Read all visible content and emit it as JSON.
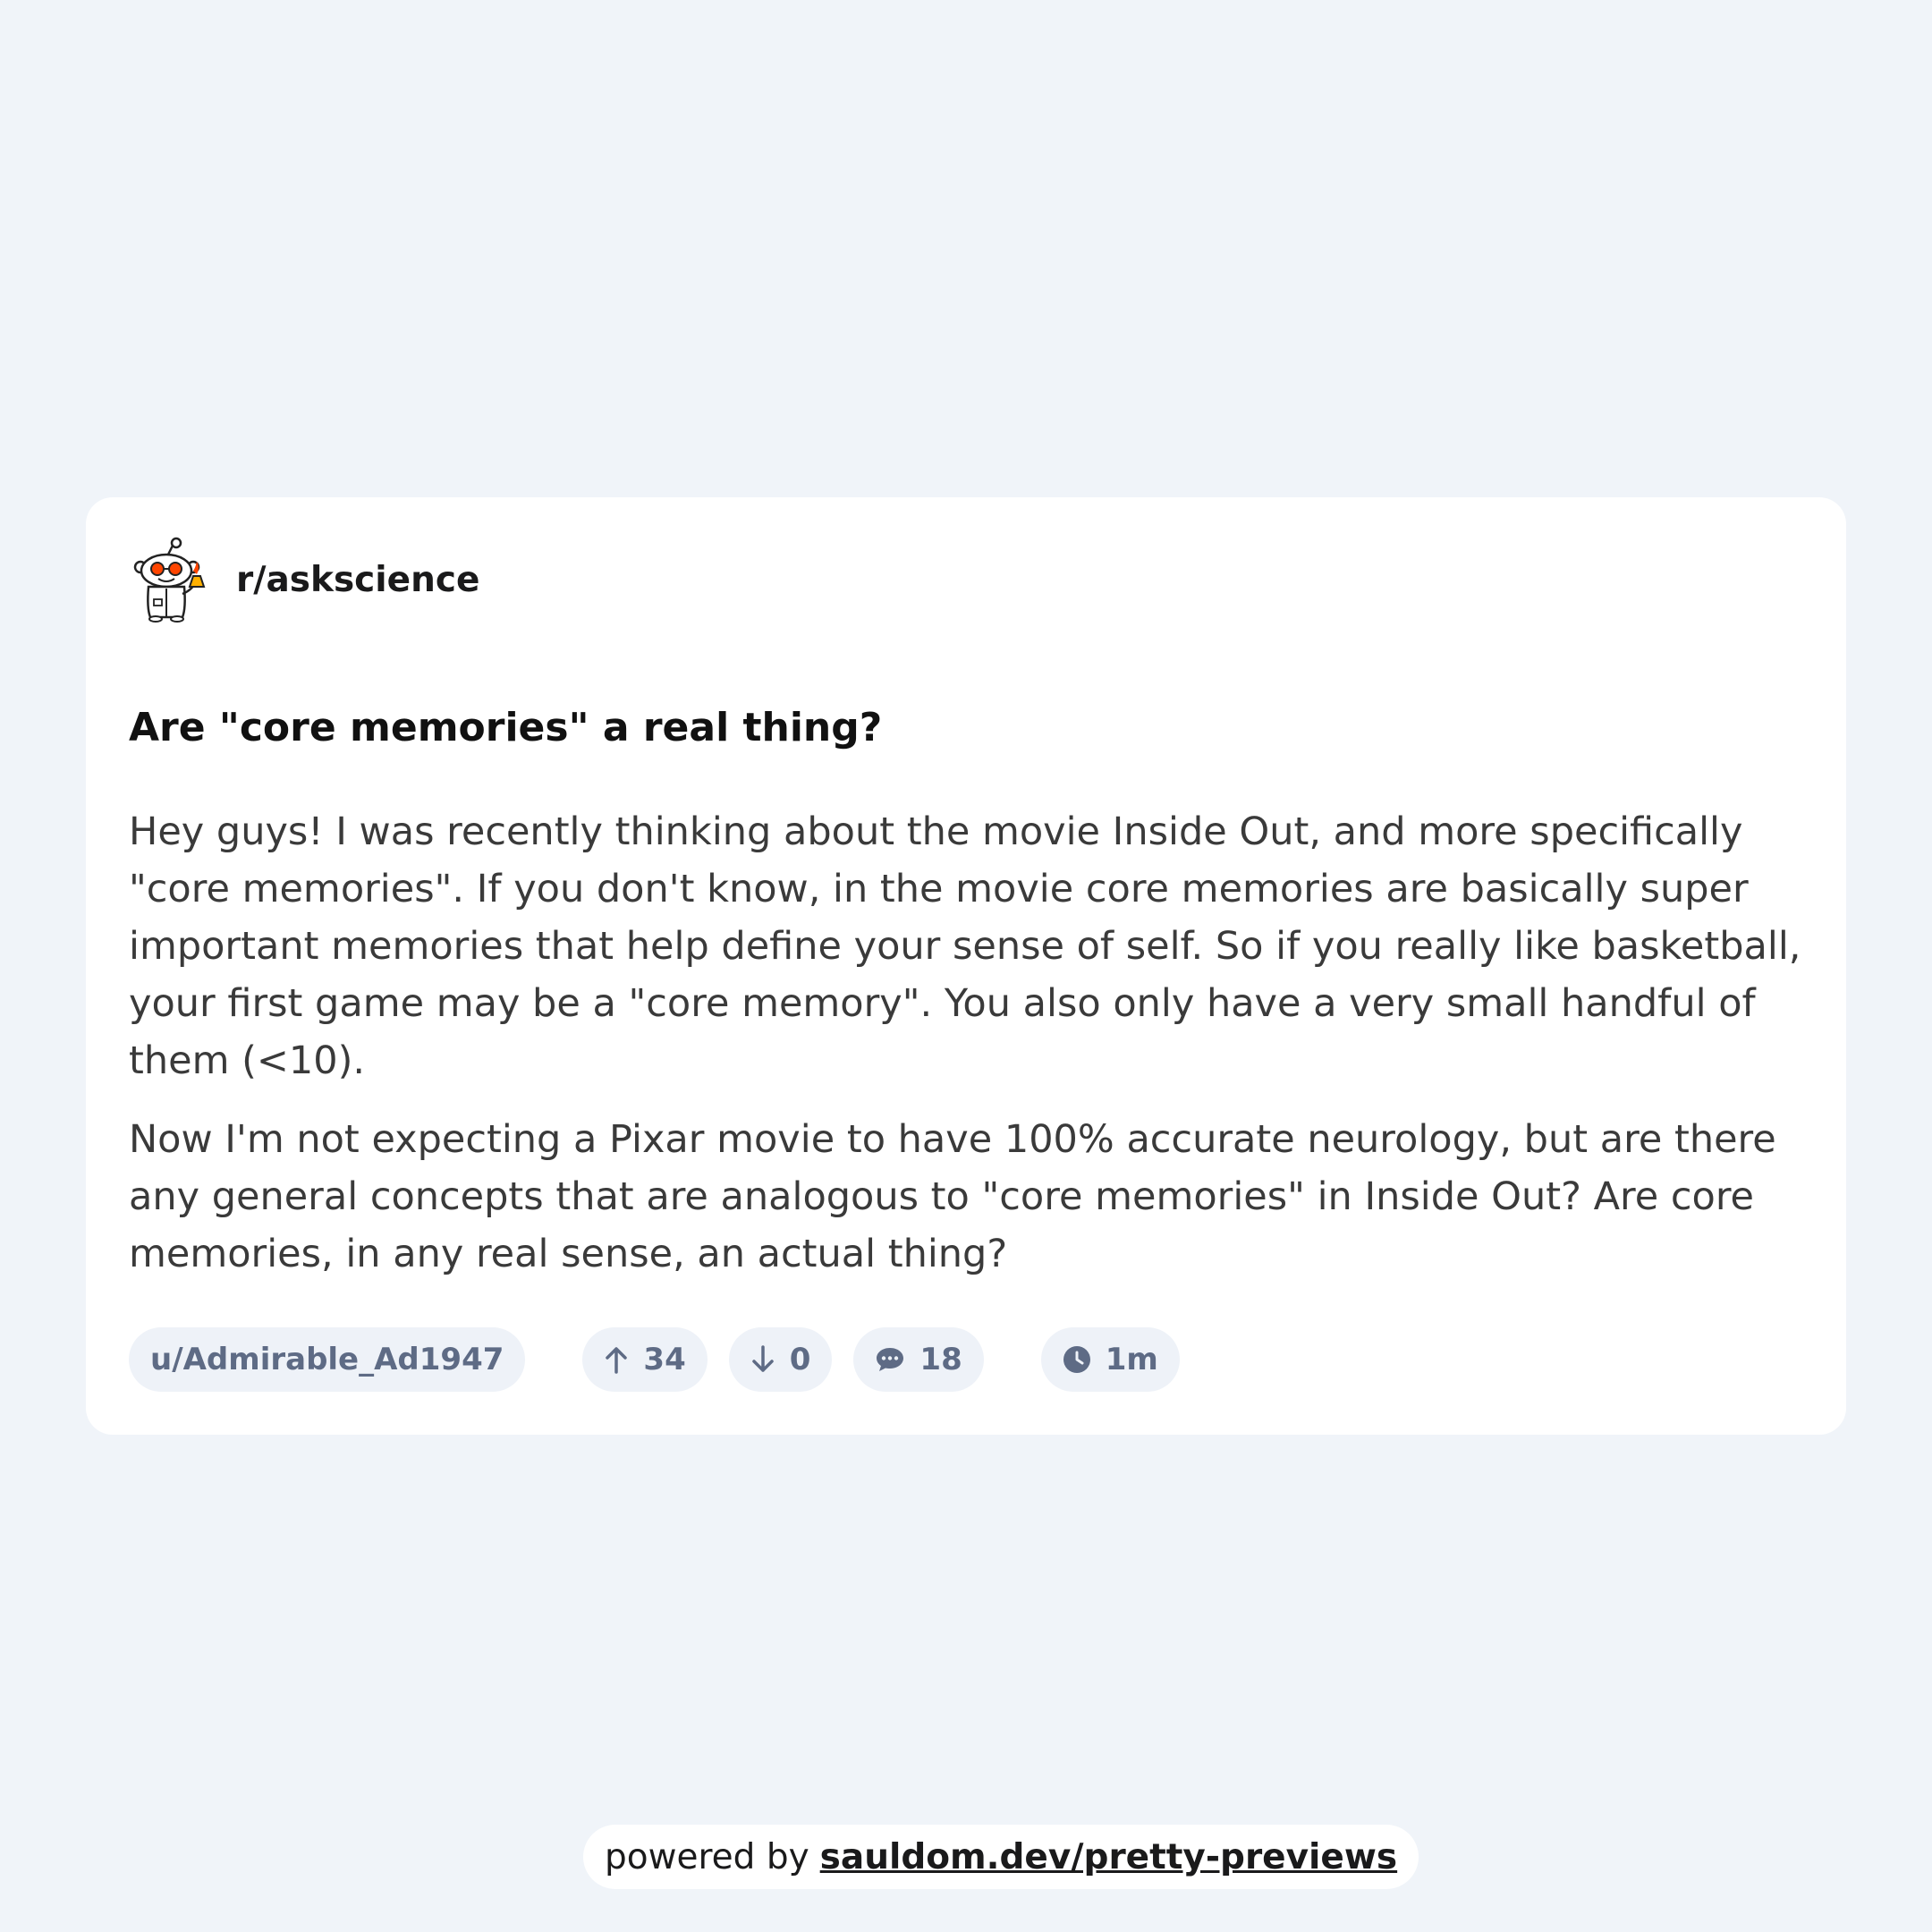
{
  "subreddit": {
    "name": "r/askscience",
    "icon": "reddit-snoo-scientist-icon"
  },
  "post": {
    "title": "Are \"core memories\" a real thing?",
    "body": [
      "Hey guys! I was recently thinking about the movie Inside Out, and more specifically \"core memories\". If you don't know, in the movie core memories are basically super important memories that help define your sense of self. So if you really like basketball, your first game may be a \"core memory\". You also only have a very small handful of them (<10).",
      "Now I'm not expecting a Pixar movie to have 100% accurate neurology, but are there any general concepts that are analogous to \"core memories\" in Inside Out? Are core memories, in any real sense, an actual thing?"
    ]
  },
  "meta": {
    "author": "u/Admirable_Ad1947",
    "upvotes": "34",
    "downvotes": "0",
    "comments": "18",
    "age": "1m",
    "icons": {
      "upvote": "arrow-up-icon",
      "downvote": "arrow-down-icon",
      "comments": "comment-bubble-icon",
      "age": "clock-icon"
    }
  },
  "footer": {
    "prefix": "powered by",
    "link": "sauldom.dev/pretty-previews"
  },
  "colors": {
    "background": "#f0f4f9",
    "card": "#ffffff",
    "pill": "#eef2f8",
    "meta_text": "#5e6b85"
  }
}
